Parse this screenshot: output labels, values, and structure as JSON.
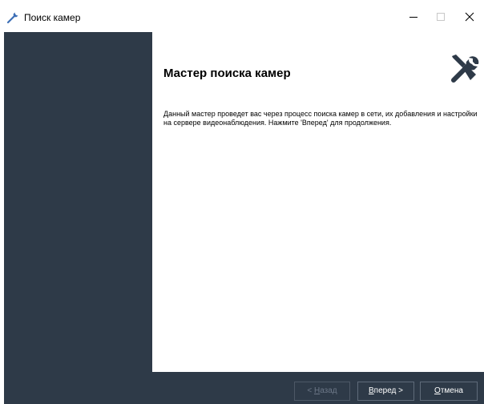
{
  "window": {
    "title": "Поиск камер"
  },
  "colors": {
    "sidebar": "#2e3a48",
    "bottombar": "#2e3a48",
    "content_bg": "#ffffff"
  },
  "content": {
    "heading": "Мастер поиска камер",
    "description": "Данный мастер проведет вас через процесс поиска камер в сети, их добавления и настройки на сервере видеонаблюдения. Нажмите 'Вперед' для продолжения."
  },
  "buttons": {
    "back": {
      "prefix": "< ",
      "accel": "Н",
      "rest": "азад",
      "enabled": false
    },
    "next": {
      "accel": "В",
      "rest": "перед >",
      "enabled": true
    },
    "cancel": {
      "accel": "О",
      "rest": "тмена",
      "enabled": true
    }
  },
  "icons": {
    "title": "tools-icon",
    "wizard": "tools-icon"
  }
}
